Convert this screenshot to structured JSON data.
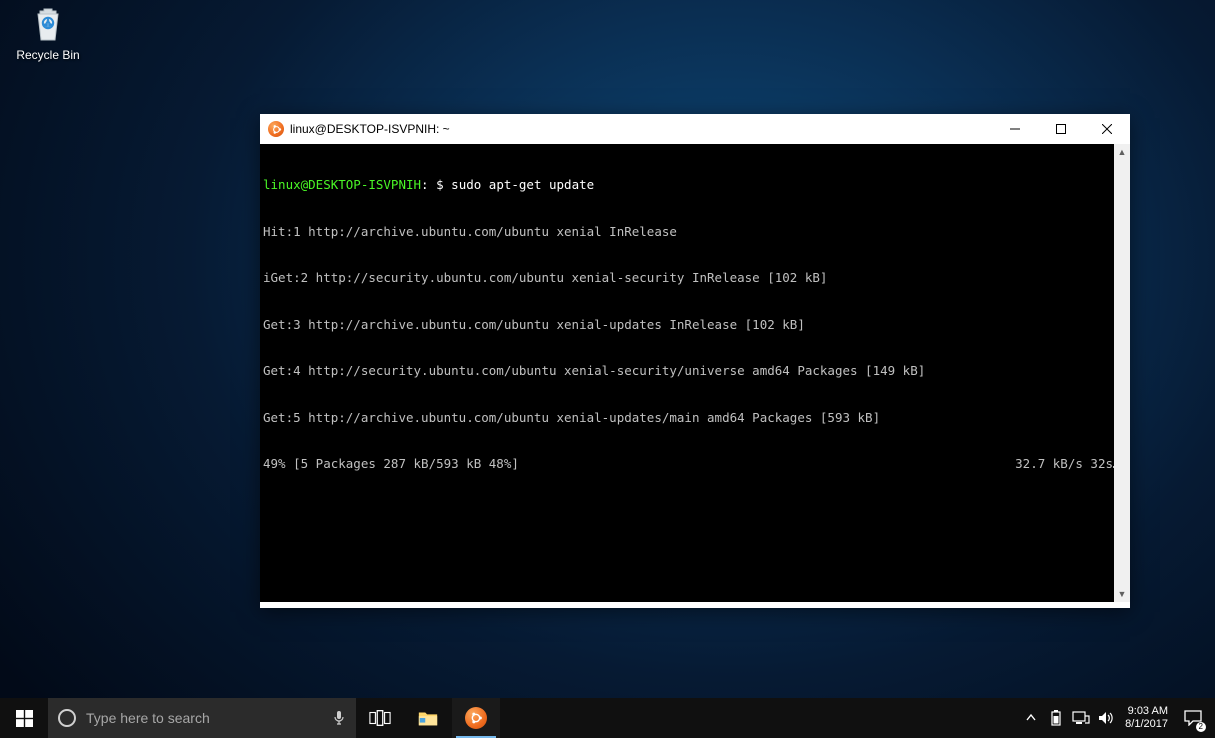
{
  "desktop": {
    "recycle_bin_label": "Recycle Bin"
  },
  "window": {
    "title": "linux@DESKTOP-ISVPNIH: ~",
    "prompt": {
      "user_host": "linux@DESKTOP-ISVPNIH",
      "separator": ":",
      "path": "~",
      "dollar": "$"
    },
    "command": "sudo apt-get update",
    "output": [
      "Hit:1 http://archive.ubuntu.com/ubuntu xenial InRelease",
      "iGet:2 http://security.ubuntu.com/ubuntu xenial-security InRelease [102 kB]",
      "Get:3 http://archive.ubuntu.com/ubuntu xenial-updates InRelease [102 kB]",
      "Get:4 http://security.ubuntu.com/ubuntu xenial-security/universe amd64 Packages [149 kB]",
      "Get:5 http://archive.ubuntu.com/ubuntu xenial-updates/main amd64 Packages [593 kB]"
    ],
    "progress_left": "49% [5 Packages 287 kB/593 kB 48%]",
    "progress_right": "32.7 kB/s 32s"
  },
  "taskbar": {
    "search_placeholder": "Type here to search",
    "clock_time": "9:03 AM",
    "clock_date": "8/1/2017",
    "action_center_badge": "2"
  }
}
